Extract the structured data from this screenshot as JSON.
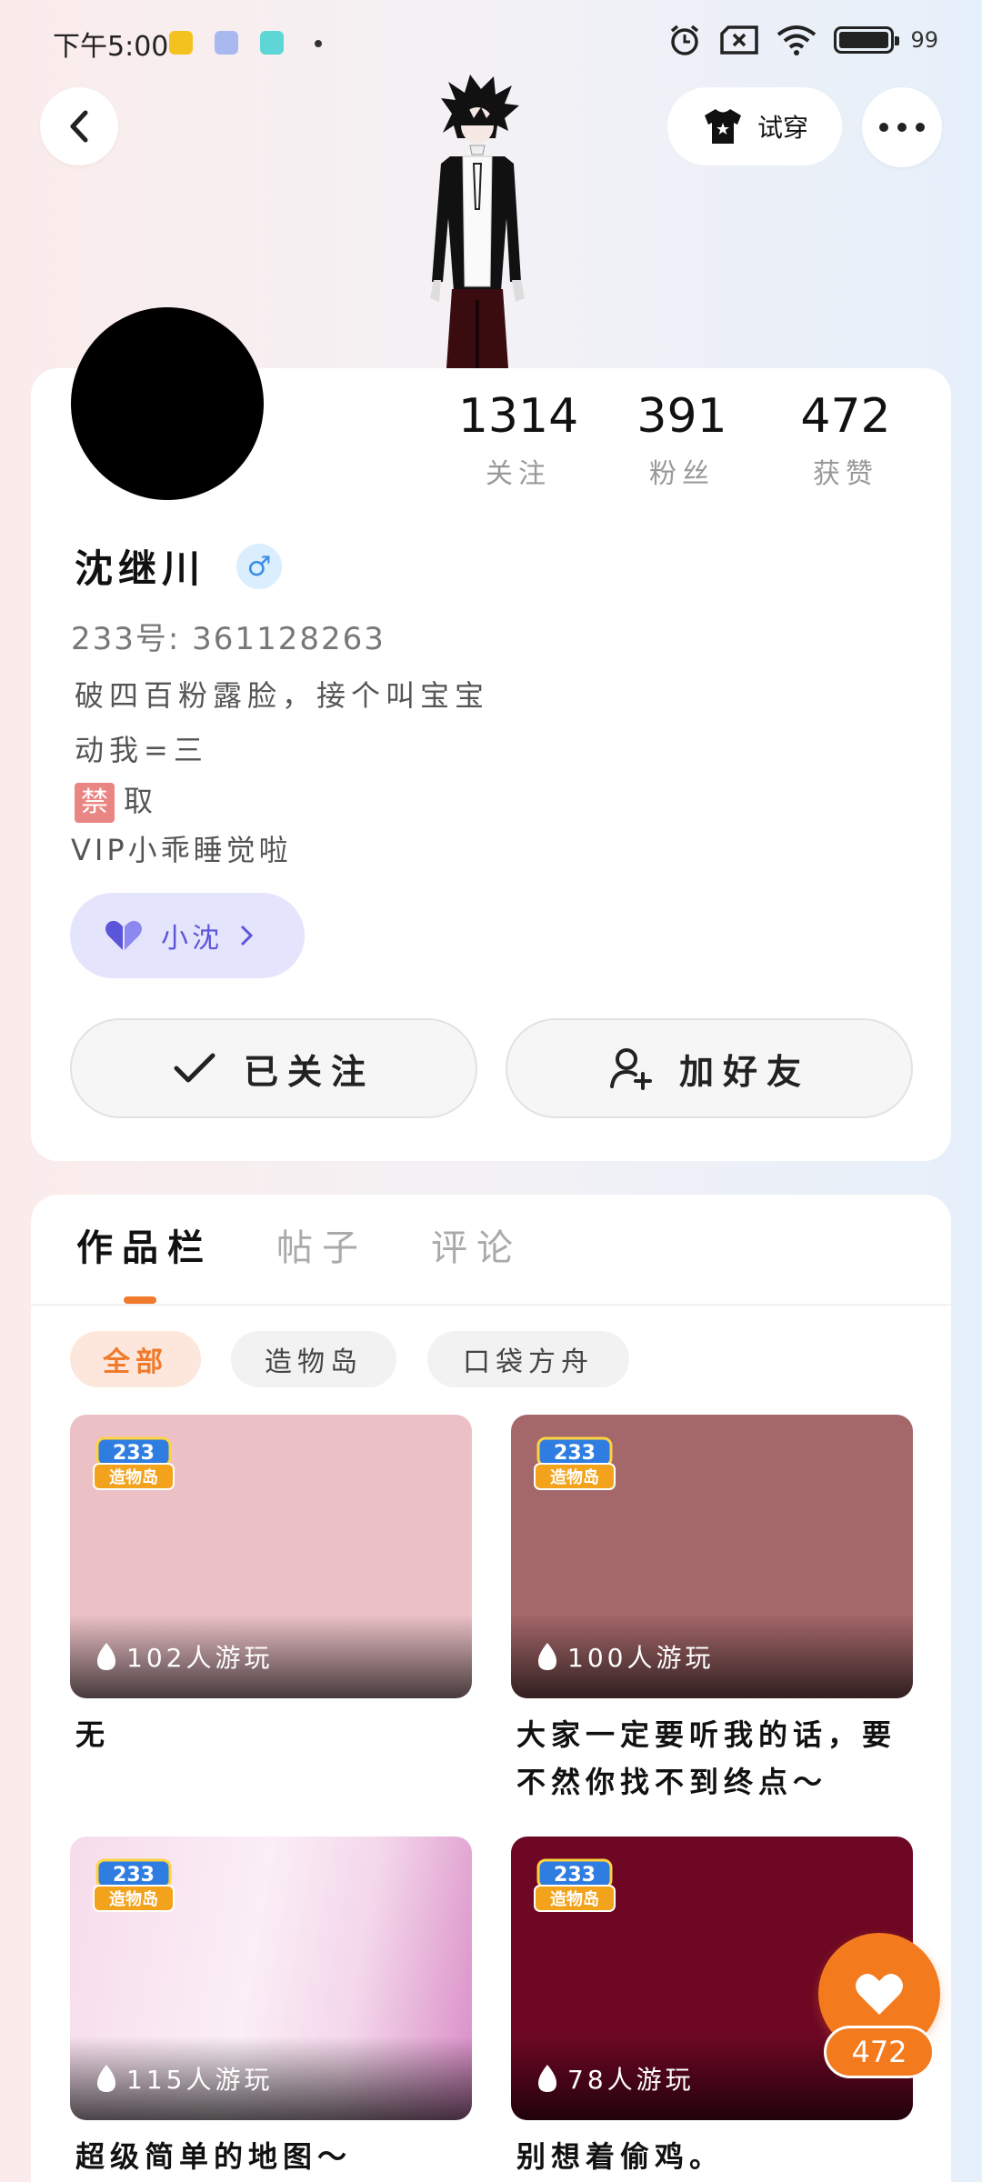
{
  "status_bar": {
    "time": "下午5:00",
    "battery": "99"
  },
  "header": {
    "try_on_label": "试穿"
  },
  "profile": {
    "name": "沈继川",
    "id_label": "233号:",
    "id_value": "361128263",
    "bio_lines": [
      "破四百粉露脸，接个叫宝宝",
      "动我=三",
      "取",
      "VIP小乖睡觉啦"
    ],
    "ban_badge": "禁",
    "tag_label": "小沈"
  },
  "stats": [
    {
      "value": "1314",
      "label": "关注"
    },
    {
      "value": "391",
      "label": "粉丝"
    },
    {
      "value": "472",
      "label": "获赞"
    }
  ],
  "actions": {
    "followed_label": "已关注",
    "add_friend_label": "加好友"
  },
  "tabs": [
    "作品栏",
    "帖子",
    "评论"
  ],
  "filters": [
    "全部",
    "造物岛",
    "口袋方舟"
  ],
  "works": [
    {
      "plays": "102人游玩",
      "title": "无",
      "color": "#ebc1c6"
    },
    {
      "plays": "100人游玩",
      "title": "大家一定要听我的话，要不然你找不到终点～",
      "color": "#a4676a"
    },
    {
      "plays": "115人游玩",
      "title": "超级简单的地图～",
      "color": "#f2cfe5"
    },
    {
      "plays": "78人游玩",
      "title": "别想着偷鸡。",
      "color": "#6d0723"
    }
  ],
  "badge_text": {
    "top": "233",
    "bottom": "造物岛"
  },
  "like_count": "472",
  "colors": {
    "accent": "#f07a2b",
    "gender_blue": "#3a8ee6",
    "tag_purple": "#5b55d9"
  }
}
